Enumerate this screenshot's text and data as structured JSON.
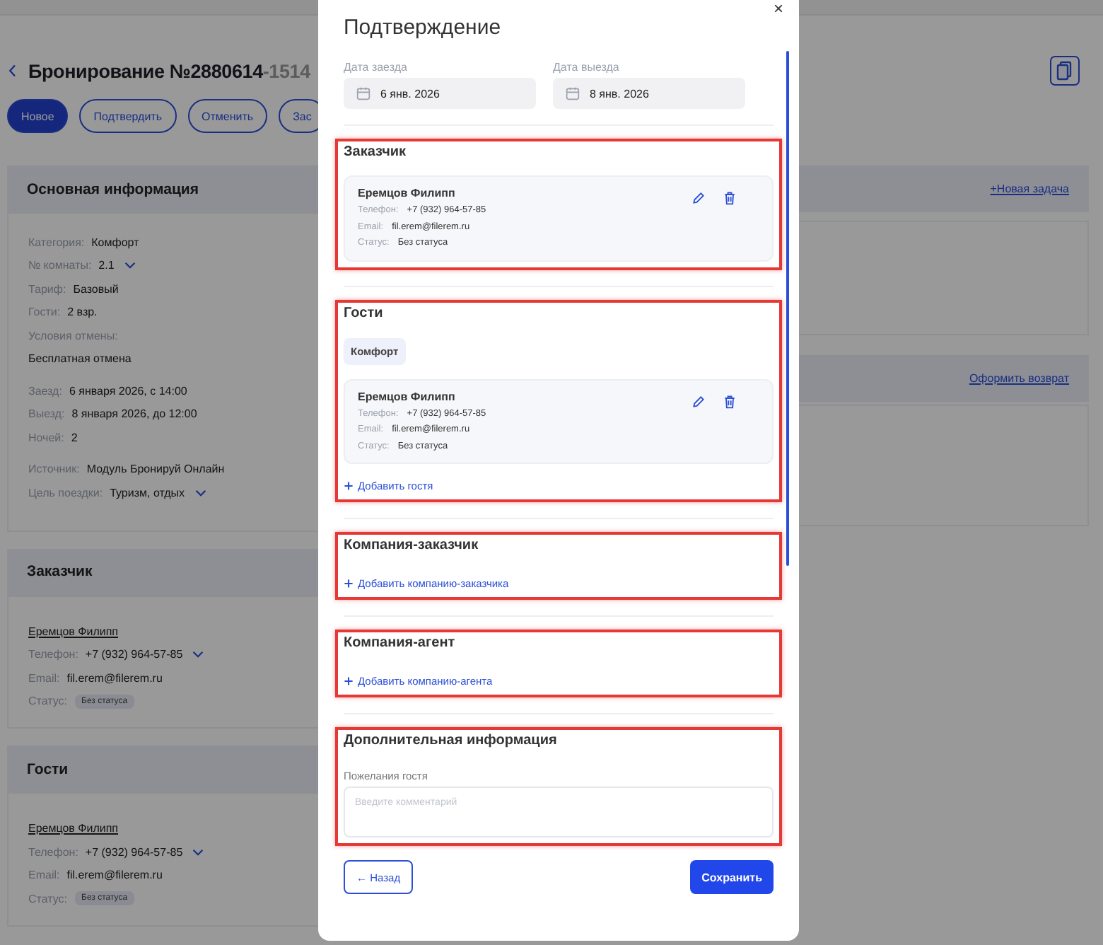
{
  "page": {
    "title": "Бронирование №2880614",
    "title_suffix": "-1514",
    "status_buttons": [
      {
        "label": "Новое",
        "selected": true
      },
      {
        "label": "Подтвердить",
        "selected": false
      },
      {
        "label": "Отменить",
        "selected": false
      },
      {
        "label": "Зас",
        "selected": false
      }
    ],
    "main_info": {
      "title": "Основная информация",
      "link": "+Новая задача",
      "groups": [
        [
          {
            "kind": "pair",
            "label": "Категория:",
            "value": "Комфорт",
            "dropdown": false
          },
          {
            "kind": "pair",
            "label": "№ комнаты:",
            "value": "2.1",
            "dropdown": true
          },
          {
            "kind": "pair",
            "label": "Тариф:",
            "value": "Базовый",
            "dropdown": false
          },
          {
            "kind": "pair",
            "label": "Гости:",
            "value": "2 взр.",
            "dropdown": false
          },
          {
            "kind": "stacked",
            "label": "Условия отмены:",
            "value": "Бесплатная отмена",
            "dropdown": false
          }
        ],
        [
          {
            "kind": "pair",
            "label": "Заезд:",
            "value": "6 января 2026, с 14:00",
            "dropdown": false
          },
          {
            "kind": "pair",
            "label": "Выезд:",
            "value": "8 января 2026, до 12:00",
            "dropdown": false
          },
          {
            "kind": "pair",
            "label": "Ночей:",
            "value": "2",
            "dropdown": false
          }
        ],
        [
          {
            "kind": "pair",
            "label": "Источник:",
            "value": "Модуль Бронируй Онлайн",
            "dropdown": false
          },
          {
            "kind": "pair",
            "label": "Цель поездки:",
            "value": "Туризм, отдых",
            "dropdown": true
          }
        ]
      ]
    },
    "refund_link": "Оформить возврат",
    "people_sections": [
      {
        "title": "Заказчик",
        "name": "Еремцов Филипп",
        "phone_label": "Телефон:",
        "phone": "+7 (932) 964-57-85",
        "email_label": "Email:",
        "email": "fil.erem@filerem.ru",
        "status_label": "Статус:",
        "status": "Без статуса"
      },
      {
        "title": "Гости",
        "name": "Еремцов Филипп",
        "phone_label": "Телефон:",
        "phone": "+7 (932) 964-57-85",
        "email_label": "Email:",
        "email": "fil.erem@filerem.ru",
        "status_label": "Статус:",
        "status": "Без статуса"
      }
    ]
  },
  "modal": {
    "title": "Подтверждение",
    "close": "×",
    "dates": [
      {
        "label": "Дата заезда",
        "value": "6 янв. 2026"
      },
      {
        "label": "Дата выезда",
        "value": "8 янв. 2026"
      }
    ],
    "sections": [
      {
        "kind": "person",
        "title": "Заказчик",
        "highlighted": true,
        "person": {
          "name": "Еремцов Филипп",
          "phone_label": "Телефон:",
          "phone": "+7 (932) 964-57-85",
          "email_label": "Email:",
          "email": "fil.erem@filerem.ru",
          "status_label": "Статус:",
          "status": "Без статуса"
        }
      },
      {
        "kind": "guests",
        "title": "Гости",
        "highlighted": true,
        "tag": "Комфорт",
        "person": {
          "name": "Еремцов Филипп",
          "phone_label": "Телефон:",
          "phone": "+7 (932) 964-57-85",
          "email_label": "Email:",
          "email": "fil.erem@filerem.ru",
          "status_label": "Статус:",
          "status": "Без статуса"
        },
        "add_link": "Добавить гостя"
      },
      {
        "kind": "add",
        "title": "Компания-заказчик",
        "highlighted": true,
        "add_link": "Добавить компанию-заказчика"
      },
      {
        "kind": "add",
        "title": "Компания-агент",
        "highlighted": true,
        "add_link": "Добавить компанию-агента"
      },
      {
        "kind": "comment",
        "title": "Дополнительная информация",
        "highlighted": true,
        "field_label": "Пожелания гостя",
        "placeholder": "Введите комментарий"
      }
    ],
    "back_button": "← Назад",
    "save_button": "Сохранить"
  }
}
